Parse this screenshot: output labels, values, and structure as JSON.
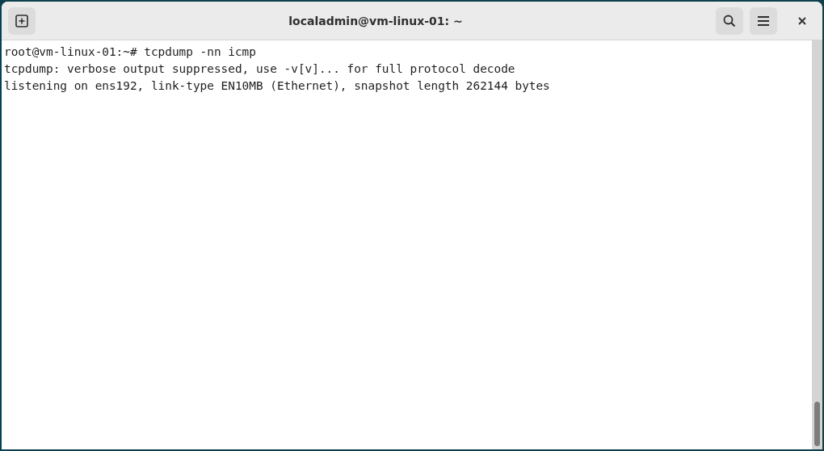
{
  "window": {
    "title": "localadmin@vm-linux-01: ~"
  },
  "terminal": {
    "lines": [
      "root@vm-linux-01:~# tcpdump -nn icmp",
      "tcpdump: verbose output suppressed, use -v[v]... for full protocol decode",
      "listening on ens192, link-type EN10MB (Ethernet), snapshot length 262144 bytes"
    ]
  }
}
